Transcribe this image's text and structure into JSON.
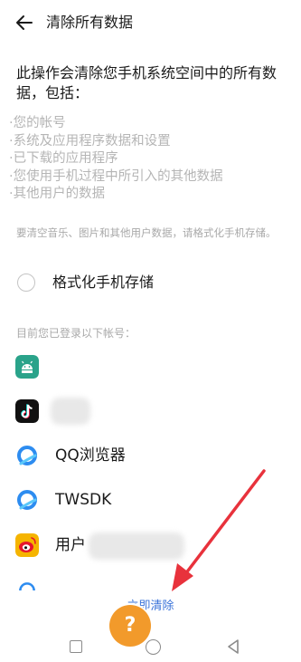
{
  "header": {
    "title": "清除所有数据"
  },
  "intro": {
    "text": "此操作会清除您手机系统空间中的所有数据，包括："
  },
  "bullets": [
    "·您的帐号",
    "·系统及应用程序数据和设置",
    "·已下载的应用程序",
    "·您使用手机过程中所引入的其他数据",
    "·其他用户的数据"
  ],
  "hint": "要清空音乐、图片和其他用户数据，请格式化手机存储。",
  "format": {
    "label": "格式化手机存储",
    "checked": false
  },
  "accounts": {
    "title": "目前您已登录以下帐号：",
    "items": [
      {
        "icon": "android-icon",
        "label": ""
      },
      {
        "icon": "tiktok-icon",
        "label": ""
      },
      {
        "icon": "qq-browser-icon",
        "label": "QQ浏览器"
      },
      {
        "icon": "twsdk-icon",
        "label": "TWSDK"
      },
      {
        "icon": "weibo-icon",
        "label": "用户"
      }
    ]
  },
  "action": {
    "clear_now_label": "立即清除"
  },
  "colors": {
    "accent": "#3b74d9",
    "annotation_arrow": "#e8323c",
    "help_badge": "#f29a2b"
  }
}
